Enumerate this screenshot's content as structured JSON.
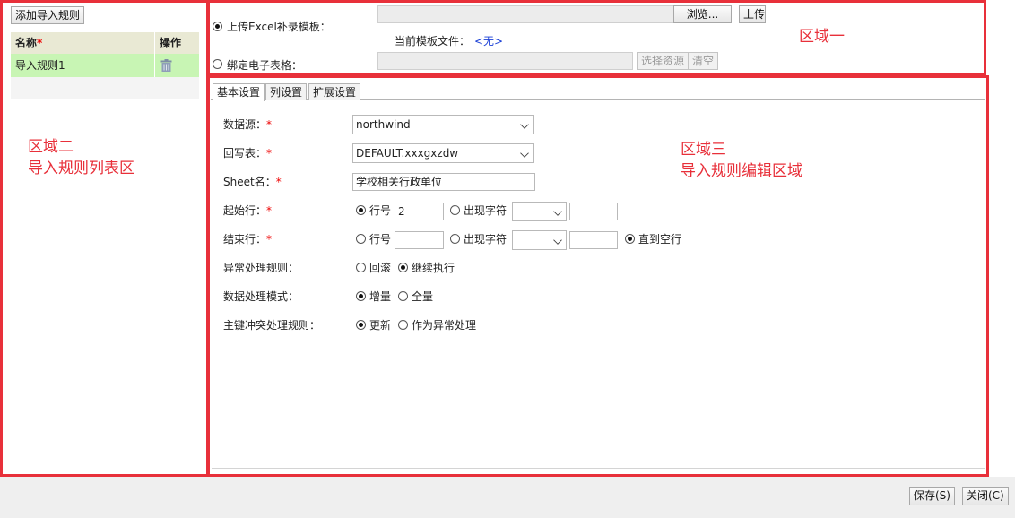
{
  "left_panel": {
    "add_button": "添加导入规则",
    "table": {
      "col_name": "名称",
      "col_name_required": "*",
      "col_action": "操作",
      "rows": [
        {
          "name": "导入规则1"
        }
      ]
    }
  },
  "top_panel": {
    "upload_radio_label": "上传Excel补录模板：",
    "browse_button": "浏览...",
    "upload_button": "上传",
    "current_template_label": "当前模板文件：",
    "current_template_value": "<无>",
    "bind_radio_label": "绑定电子表格：",
    "select_resource_button": "选择资源",
    "clear_button": "清空"
  },
  "tabs": [
    "基本设置",
    "列设置",
    "扩展设置"
  ],
  "form": {
    "datasource_label": "数据源：",
    "datasource_value": "northwind",
    "writeback_label": "回写表：",
    "writeback_value": "DEFAULT.xxxgxzdw",
    "sheet_label": "Sheet名：",
    "sheet_value": "学校相关行政单位",
    "start_row_label": "起始行：",
    "row_number_label": "行号",
    "start_row_value": "2",
    "appear_char_label": "出现字符",
    "end_row_label": "结束行：",
    "until_empty_label": "直到空行",
    "exception_label": "异常处理规则：",
    "rollback_label": "回滚",
    "continue_label": "继续执行",
    "mode_label": "数据处理模式：",
    "incremental_label": "增量",
    "full_label": "全量",
    "conflict_label": "主键冲突处理规则：",
    "update_label": "更新",
    "as_exception_label": "作为异常处理",
    "required_mark": "*"
  },
  "footer": {
    "save_button": "保存(S)",
    "close_button": "关闭(C)"
  },
  "annotations": {
    "area1": "区域一",
    "area2_line1": "区域二",
    "area2_line2": "导入规则列表区",
    "area3_line1": "区域三",
    "area3_line2": "导入规则编辑区域"
  },
  "colors": {
    "annotation_red": "#e8303a",
    "selected_row_bg": "#c8f5b4",
    "table_header_bg": "#e9e9d4",
    "link_blue": "#1a3fd6"
  }
}
